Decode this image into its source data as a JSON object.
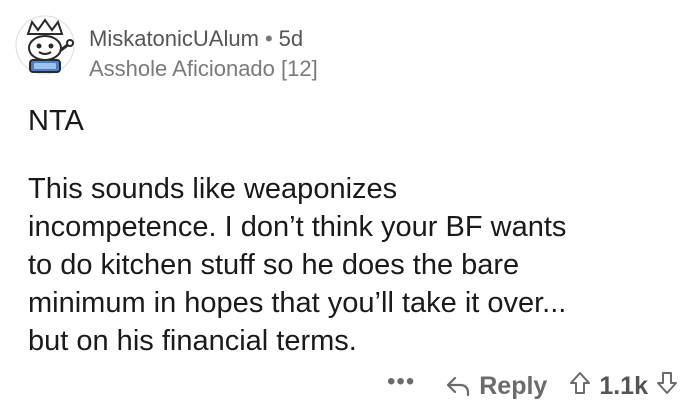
{
  "comment": {
    "username": "MiskatonicUAlum",
    "separator": "•",
    "age": "5d",
    "flair": "Asshole Aficionado [12]",
    "verdict": "NTA",
    "body": "This sounds like weaponizes\nincompetence. I don’t think your BF wants\nto do kitchen stuff so he does the bare\nminimum in hopes that you’ll take it over...\nbut on his financial terms.",
    "actions": {
      "more": "•••",
      "reply_label": "Reply",
      "score": "1.1k"
    }
  },
  "icons": {
    "avatar": "snoo-avatar-icon",
    "reply": "reply-arrow-icon",
    "upvote": "upvote-arrow-icon",
    "downvote": "downvote-arrow-icon"
  }
}
